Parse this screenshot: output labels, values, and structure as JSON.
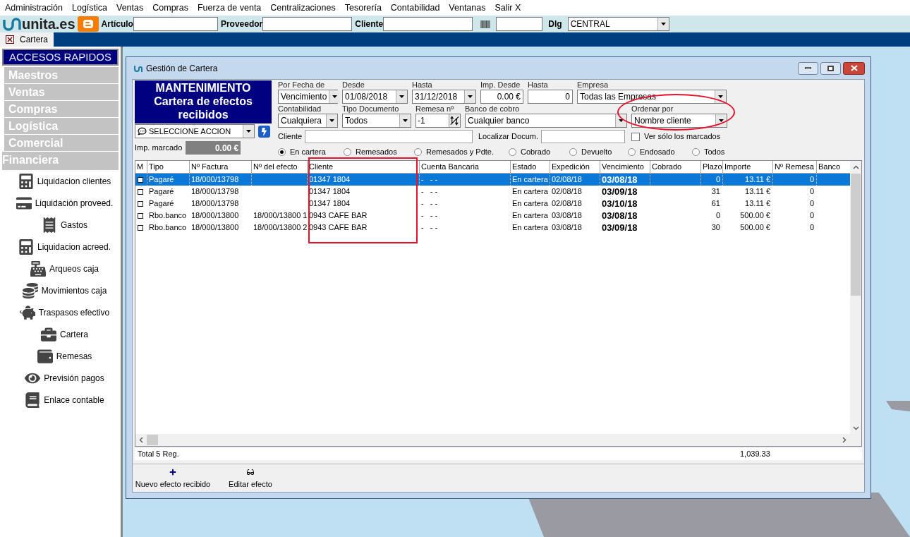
{
  "menu": [
    "Administración",
    "Logística",
    "Ventas",
    "Compras",
    "Fuerza de venta",
    "Centralizaciones",
    "Tesorería",
    "Contabilidad",
    "Ventanas",
    "Salir X"
  ],
  "toolbar": {
    "logo": "unita.es",
    "fields": [
      {
        "label": "Artículo"
      },
      {
        "label": "Proveedor"
      },
      {
        "label": "Cliente"
      }
    ],
    "dlg": {
      "label": "Dlg",
      "value": "CENTRAL"
    }
  },
  "tabs": [
    {
      "label": "Cartera",
      "selected": true
    }
  ],
  "sidebar": {
    "title": "ACCESOS RAPIDOS",
    "sections": [
      {
        "label": "Maestros",
        "expanded": false
      },
      {
        "label": "Ventas",
        "expanded": false
      },
      {
        "label": "Compras",
        "expanded": false
      },
      {
        "label": "Logística",
        "expanded": false
      },
      {
        "label": "Comercial",
        "expanded": false
      },
      {
        "label": "Financiera",
        "expanded": true,
        "children": [
          {
            "label": "Liquidacion clientes"
          },
          {
            "label": "Liquidación proveed."
          },
          {
            "label": "Gastos"
          },
          {
            "label": "Liquidacion acreed."
          },
          {
            "label": "Arqueos caja"
          },
          {
            "label": "Movimientos caja"
          },
          {
            "label": "Traspasos efectivo"
          },
          {
            "label": "Cartera"
          },
          {
            "label": "Remesas"
          },
          {
            "label": "Previsión pagos"
          },
          {
            "label": "Enlace contable"
          }
        ]
      }
    ]
  },
  "window": {
    "title": "Gestión de Cartera",
    "heading": "MANTENIMIENTO",
    "subheading": "Cartera de efectos recibidos",
    "action": "SELECCIONE ACCION",
    "marked": {
      "label": "Imp. marcado",
      "value": "0.00 €"
    },
    "filters": [
      [
        {
          "label": "Por Fecha de",
          "value": "Vencimiento",
          "kind": "select"
        },
        {
          "label": "Desde",
          "value": "01/08/2018",
          "kind": "select"
        },
        {
          "label": "Hasta",
          "value": "31/12/2018",
          "kind": "select"
        },
        {
          "label": "Imp. Desde",
          "value": "0.00 €",
          "kind": "input"
        },
        {
          "label": "Hasta",
          "value": "0",
          "kind": "input"
        },
        {
          "label": "Empresa",
          "value": "Todas las Empresas",
          "kind": "select"
        }
      ],
      [
        {
          "label": "Contabilidad",
          "value": "Cualquiera",
          "kind": "select"
        },
        {
          "label": "Tipo Documento",
          "value": "Todos",
          "kind": "select"
        },
        {
          "label": "Remesa nº",
          "value": "-1",
          "kind": "spin"
        },
        {
          "label": "Banco de cobro",
          "value": "Cualquier banco",
          "kind": "select"
        },
        {
          "label": "Ordenar por",
          "value": "Nombre cliente",
          "kind": "select"
        }
      ]
    ],
    "cliente": {
      "label": "Cliente"
    },
    "localizar": {
      "label": "Localizar Docum."
    },
    "only_marked": {
      "label": "Ver sólo los marcados",
      "checked": false
    },
    "status_options": [
      {
        "label": "En cartera",
        "selected": true
      },
      {
        "label": "Remesados",
        "selected": false
      },
      {
        "label": "Remesados y Pdte.",
        "selected": false
      },
      {
        "label": "Cobrado",
        "selected": false
      },
      {
        "label": "Devuelto",
        "selected": false
      },
      {
        "label": "Endosado",
        "selected": false
      },
      {
        "label": "Todos",
        "selected": false
      }
    ],
    "table": {
      "columns": [
        "M",
        "Tipo",
        "Nº Factura",
        "Nº del efecto",
        "Cliente",
        "Cuenta Bancaria",
        "Estado",
        "Expedición",
        "Vencimiento",
        "Cobrado",
        "Plazo",
        "Importe",
        "Nº Remesa",
        "Banco"
      ],
      "rows": [
        {
          "selected": true,
          "checked": false,
          "tipo": "Pagaré",
          "factura": "18/000/13798",
          "cliente": "01347 1804",
          "cuenta": "-   - -",
          "estado": "En cartera",
          "expedicion": "02/08/18",
          "vencimiento": "03/08/18",
          "plazo": "0",
          "importe": "13.11 €",
          "remesa": "0"
        },
        {
          "selected": false,
          "checked": false,
          "tipo": "Pagaré",
          "factura": "18/000/13798",
          "cliente": "01347 1804",
          "cuenta": "-   - -",
          "estado": "En cartera",
          "expedicion": "02/08/18",
          "vencimiento": "03/09/18",
          "plazo": "31",
          "importe": "13.11 €",
          "remesa": "0"
        },
        {
          "selected": false,
          "checked": false,
          "tipo": "Pagaré",
          "factura": "18/000/13798",
          "cliente": "01347 1804",
          "cuenta": "-   - -",
          "estado": "En cartera",
          "expedicion": "02/08/18",
          "vencimiento": "03/10/18",
          "plazo": "61",
          "importe": "13.11 €",
          "remesa": "0"
        },
        {
          "selected": false,
          "checked": false,
          "tipo": "Rbo.banco",
          "factura": "18/000/13800",
          "efecto": "18/000/13800 1",
          "cliente": "0943 CAFE BAR",
          "cuenta": "-   - -",
          "estado": "En cartera",
          "expedicion": "03/08/18",
          "vencimiento": "03/08/18",
          "plazo": "0",
          "importe": "500.00 €",
          "remesa": "0"
        },
        {
          "selected": false,
          "checked": false,
          "tipo": "Rbo.banco",
          "factura": "18/000/13800",
          "efecto": "18/000/13800 2",
          "cliente": "0943 CAFE BAR",
          "cuenta": "-   - -",
          "estado": "En cartera",
          "expedicion": "03/08/18",
          "vencimiento": "03/09/18",
          "plazo": "30",
          "importe": "500.00 €",
          "remesa": "0"
        }
      ]
    },
    "total": {
      "label": "Total 5 Reg.",
      "importe": "1,039.33"
    },
    "actions": [
      {
        "label": "Nuevo efecto recibido"
      },
      {
        "label": "Editar efecto"
      }
    ]
  },
  "annotations": [
    {
      "kind": "rectangle"
    },
    {
      "kind": "ellipse"
    }
  ]
}
